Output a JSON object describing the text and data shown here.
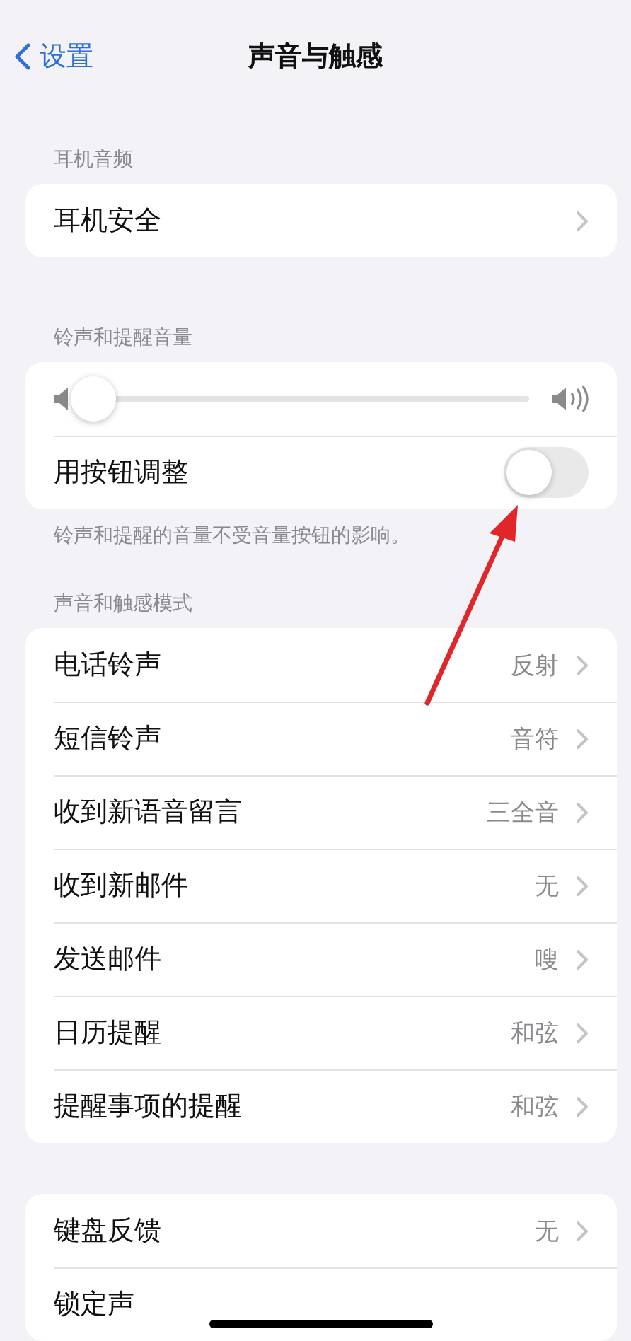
{
  "nav": {
    "back": "设置",
    "title": "声音与触感"
  },
  "sections": [
    {
      "header": "耳机音频",
      "rows": [
        {
          "kind": "link",
          "label": "耳机安全"
        }
      ]
    },
    {
      "header": "铃声和提醒音量",
      "footer": "铃声和提醒的音量不受音量按钮的影响。",
      "rows": [
        {
          "kind": "slider",
          "level": 0.0
        },
        {
          "kind": "toggle",
          "label": "用按钮调整",
          "on": false
        }
      ]
    },
    {
      "header": "声音和触感模式",
      "rows": [
        {
          "kind": "link",
          "label": "电话铃声",
          "value": "反射"
        },
        {
          "kind": "link",
          "label": "短信铃声",
          "value": "音符"
        },
        {
          "kind": "link",
          "label": "收到新语音留言",
          "value": "三全音"
        },
        {
          "kind": "link",
          "label": "收到新邮件",
          "value": "无"
        },
        {
          "kind": "link",
          "label": "发送邮件",
          "value": "嗖"
        },
        {
          "kind": "link",
          "label": "日历提醒",
          "value": "和弦"
        },
        {
          "kind": "link",
          "label": "提醒事项的提醒",
          "value": "和弦"
        }
      ]
    },
    {
      "rows": [
        {
          "kind": "link",
          "label": "键盘反馈",
          "value": "无"
        },
        {
          "kind": "plain",
          "label": "锁定声"
        }
      ]
    }
  ]
}
